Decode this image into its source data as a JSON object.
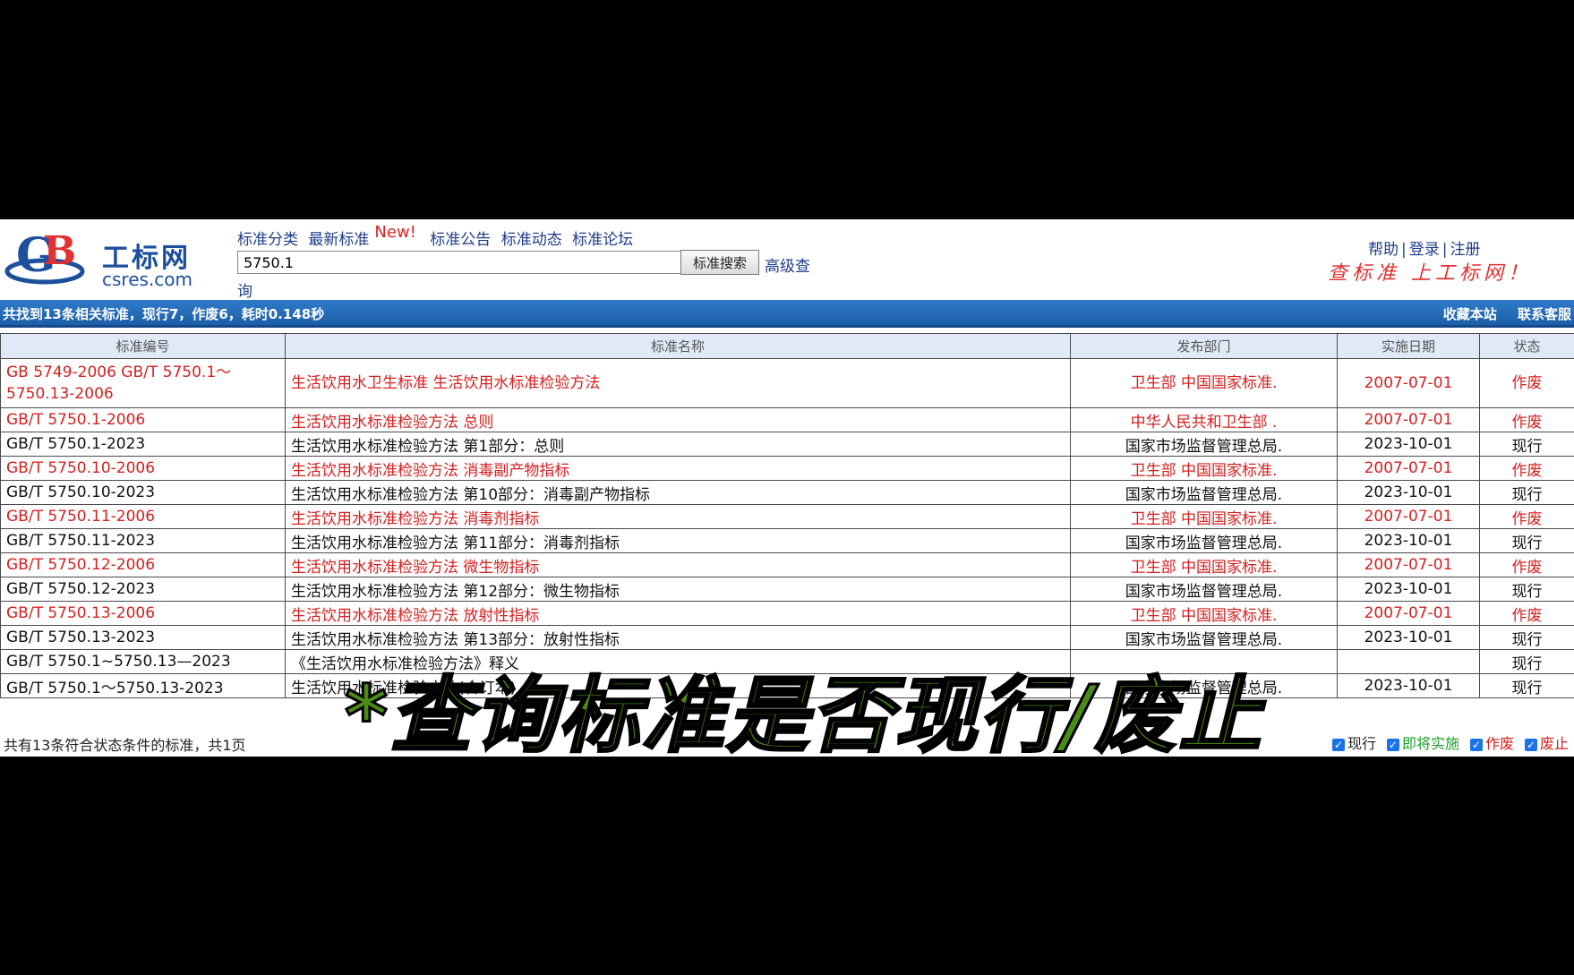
{
  "header": {
    "logo_cn": "工标网",
    "logo_en": "csres.com",
    "nav": [
      "标准分类",
      "最新标准",
      "标准公告",
      "标准动态",
      "标准论坛"
    ],
    "new_badge": "New!",
    "search_value": "5750.1",
    "search_button": "标准搜索",
    "advanced_1": "高级查",
    "advanced_2": "询",
    "account": [
      "帮助",
      "登录",
      "注册"
    ],
    "slogan": "查标准 上工标网！"
  },
  "infobar": {
    "summary": "共找到13条相关标准，现行7，作废6，耗时0.148秒",
    "links": [
      "收藏本站",
      "联系客服"
    ]
  },
  "table": {
    "headers": [
      "标准编号",
      "标准名称",
      "发布部门",
      "实施日期",
      "状态"
    ],
    "rows": [
      {
        "code": "GB 5749-2006 GB/T 5750.1～5750.13-2006",
        "name": "生活饮用水卫生标准 生活饮用水标准检验方法",
        "dept": "卫生部 中国国家标准.",
        "date": "2007-07-01",
        "status": "作废"
      },
      {
        "code": "GB/T 5750.1-2006",
        "name": "生活饮用水标准检验方法 总则",
        "dept": "中华人民共和卫生部 .",
        "date": "2007-07-01",
        "status": "作废"
      },
      {
        "code": "GB/T 5750.1-2023",
        "name": "生活饮用水标准检验方法 第1部分：总则",
        "dept": "国家市场监督管理总局.",
        "date": "2023-10-01",
        "status": "现行"
      },
      {
        "code": "GB/T 5750.10-2006",
        "name": "生活饮用水标准检验方法 消毒副产物指标",
        "dept": "卫生部 中国国家标准.",
        "date": "2007-07-01",
        "status": "作废"
      },
      {
        "code": "GB/T 5750.10-2023",
        "name": "生活饮用水标准检验方法 第10部分：消毒副产物指标",
        "dept": "国家市场监督管理总局.",
        "date": "2023-10-01",
        "status": "现行"
      },
      {
        "code": "GB/T 5750.11-2006",
        "name": "生活饮用水标准检验方法 消毒剂指标",
        "dept": "卫生部 中国国家标准.",
        "date": "2007-07-01",
        "status": "作废"
      },
      {
        "code": "GB/T 5750.11-2023",
        "name": "生活饮用水标准检验方法 第11部分：消毒剂指标",
        "dept": "国家市场监督管理总局.",
        "date": "2023-10-01",
        "status": "现行"
      },
      {
        "code": "GB/T 5750.12-2006",
        "name": "生活饮用水标准检验方法 微生物指标",
        "dept": "卫生部 中国国家标准.",
        "date": "2007-07-01",
        "status": "作废"
      },
      {
        "code": "GB/T 5750.12-2023",
        "name": "生活饮用水标准检验方法 第12部分：微生物指标",
        "dept": "国家市场监督管理总局.",
        "date": "2023-10-01",
        "status": "现行"
      },
      {
        "code": "GB/T 5750.13-2006",
        "name": "生活饮用水标准检验方法 放射性指标",
        "dept": "卫生部 中国国家标准.",
        "date": "2007-07-01",
        "status": "作废"
      },
      {
        "code": "GB/T 5750.13-2023",
        "name": "生活饮用水标准检验方法 第13部分：放射性指标",
        "dept": "国家市场监督管理总局.",
        "date": "2023-10-01",
        "status": "现行"
      },
      {
        "code": "GB/T 5750.1~5750.13—2023",
        "name": "《生活饮用水标准检验方法》释义",
        "dept": "",
        "date": "",
        "status": "现行"
      },
      {
        "code": "GB/T 5750.1～5750.13-2023",
        "name": "生活饮用水标准检验方法(合订本)",
        "dept": "国家市场监督管理总局.",
        "date": "2023-10-01",
        "status": "现行"
      }
    ]
  },
  "footer": {
    "summary": "共有13条符合状态条件的标准，共1页",
    "filters": [
      {
        "label": "现行",
        "color": "#222222"
      },
      {
        "label": "即将实施",
        "color": "#1e9e2a"
      },
      {
        "label": "作废",
        "color": "#d42020"
      },
      {
        "label": "废止",
        "color": "#d42020"
      }
    ]
  },
  "overlay_caption": "*查询标准是否现行/废止"
}
